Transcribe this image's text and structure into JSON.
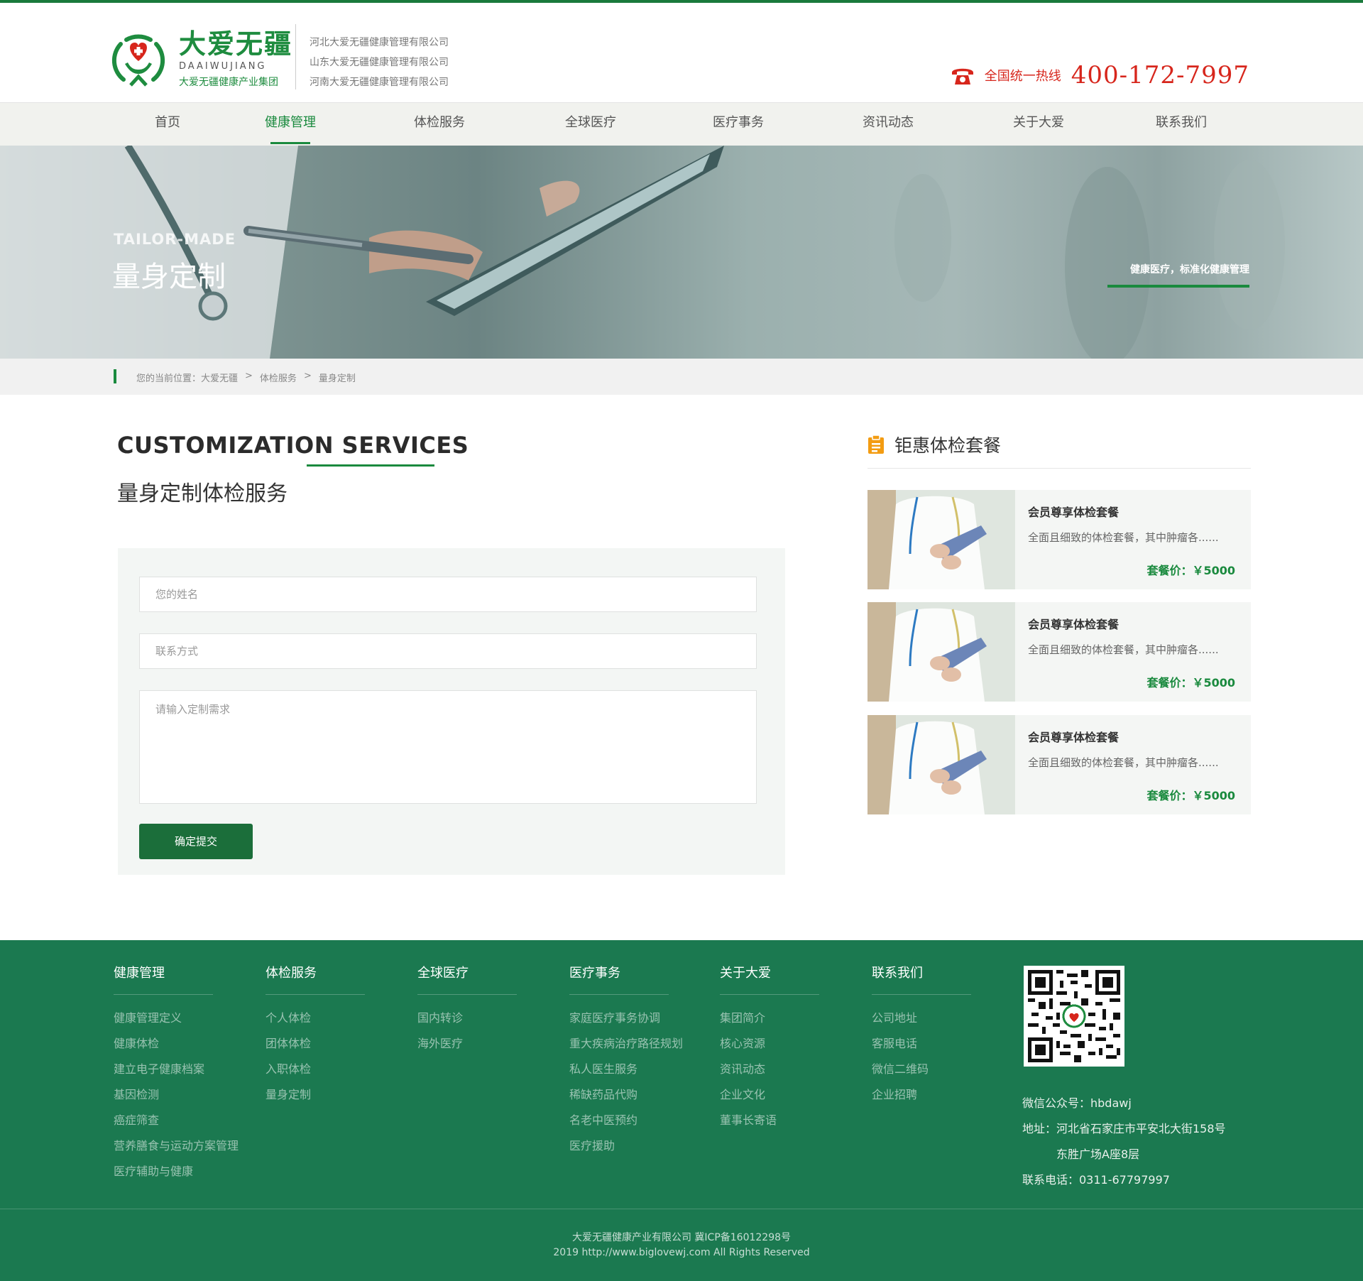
{
  "header": {
    "brand_cn": "大爱无疆",
    "brand_en": "DAAIWUJIANG",
    "brand_sub": "大爱无疆健康产业集团",
    "companies": [
      "河北大爱无疆健康管理有限公司",
      "山东大爱无疆健康管理有限公司",
      "河南大爱无疆健康管理有限公司"
    ],
    "hotline_label": "全国统一热线",
    "hotline_number": "400-172-7997"
  },
  "nav": {
    "items": [
      {
        "label": "首页"
      },
      {
        "label": "健康管理"
      },
      {
        "label": "体检服务"
      },
      {
        "label": "全球医疗"
      },
      {
        "label": "医疗事务"
      },
      {
        "label": "资讯动态"
      },
      {
        "label": "关于大爱"
      },
      {
        "label": "联系我们"
      }
    ],
    "active": "健康管理"
  },
  "banner": {
    "en": "TAILOR-MADE",
    "cn": "量身定制",
    "right": "健康医疗，标准化健康管理"
  },
  "breadcrumb": {
    "prefix": "您的当前位置：大爱无疆",
    "sep": ">",
    "level2": "体检服务",
    "level3": "量身定制"
  },
  "main": {
    "title_en": "CUSTOMIZATION SERVICES",
    "title_cn": "量身定制体检服务",
    "form": {
      "name_placeholder": "您的姓名",
      "contact_placeholder": "联系方式",
      "needs_placeholder": "请输入定制需求",
      "submit_label": "确定提交"
    }
  },
  "sidebar": {
    "title": "钜惠体检套餐",
    "cards": [
      {
        "title": "会员尊享体检套餐",
        "desc": "全面且细致的体检套餐，其中肿瘤各......",
        "price": "套餐价：￥5000"
      },
      {
        "title": "会员尊享体检套餐",
        "desc": "全面且细致的体检套餐，其中肿瘤各......",
        "price": "套餐价：￥5000"
      },
      {
        "title": "会员尊享体检套餐",
        "desc": "全面且细致的体检套餐，其中肿瘤各......",
        "price": "套餐价：￥5000"
      }
    ]
  },
  "footer": {
    "columns": [
      {
        "heading": "健康管理",
        "links": [
          "健康管理定义",
          "健康体检",
          "建立电子健康档案",
          "基因检测",
          "癌症筛查",
          "营养膳食与运动方案管理",
          "医疗辅助与健康"
        ]
      },
      {
        "heading": "体检服务",
        "links": [
          "个人体检",
          "团体体检",
          "入职体检",
          "量身定制"
        ]
      },
      {
        "heading": "全球医疗",
        "links": [
          "国内转诊",
          "海外医疗"
        ]
      },
      {
        "heading": "医疗事务",
        "links": [
          "家庭医疗事务协调",
          "重大疾病治疗路径规划",
          "私人医生服务",
          "稀缺药品代购",
          "名老中医预约",
          "医疗援助"
        ]
      },
      {
        "heading": "关于大爱",
        "links": [
          "集团简介",
          "核心资源",
          "资讯动态",
          "企业文化",
          "董事长寄语"
        ]
      },
      {
        "heading": "联系我们",
        "links": [
          "公司地址",
          "客服电话",
          "微信二维码",
          "企业招聘"
        ]
      }
    ],
    "wechat": "微信公众号：hbdawj",
    "address1": "地址：河北省石家庄市平安北大街158号",
    "address2": "东胜广场A座8层",
    "phone": "联系电话：0311-67797997",
    "copyright1": "大爱无疆健康产业有限公司 冀ICP备16012298号",
    "copyright2": "2019 http://www.biglovewj.com All Rights Reserved"
  },
  "colors": {
    "brand_green": "#1a8a3e",
    "footer_green": "#1b7950",
    "hotline_red": "#d7261c"
  }
}
